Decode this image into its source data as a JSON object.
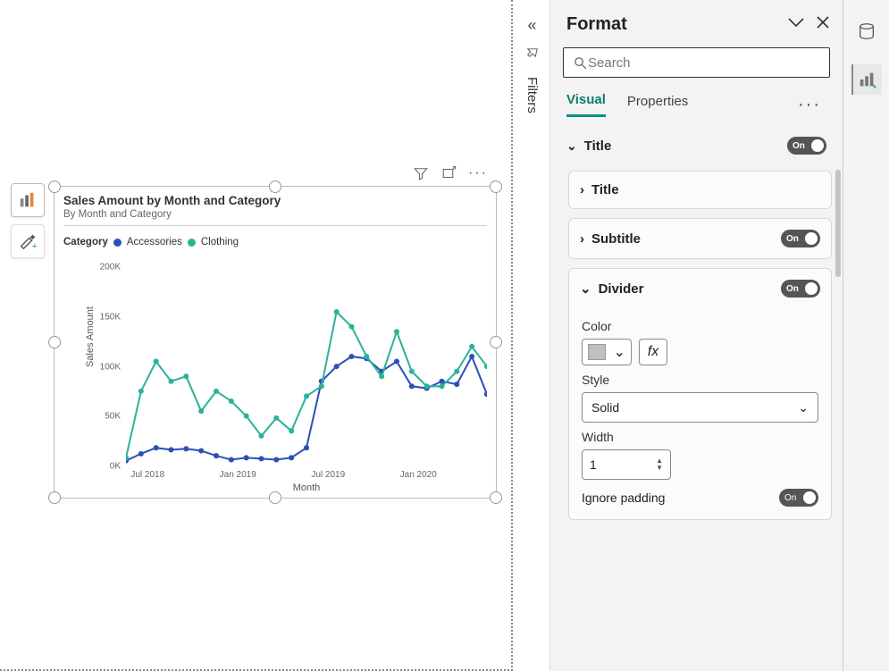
{
  "canvas": {
    "toolbar": {
      "build": "build-visual-icon",
      "format": "format-visual-icon"
    }
  },
  "viz": {
    "title": "Sales Amount by Month and Category",
    "subtitle": "By Month and Category",
    "legend_label": "Category",
    "series1_name": "Accessories",
    "series2_name": "Clothing",
    "y_label": "Sales Amount",
    "x_label": "Month",
    "y_ticks": [
      "200K",
      "150K",
      "100K",
      "50K",
      "0K"
    ],
    "x_ticks": [
      "Jul 2018",
      "Jan 2019",
      "Jul 2019",
      "Jan 2020"
    ]
  },
  "filters": {
    "label": "Filters"
  },
  "format": {
    "title": "Format",
    "search_placeholder": "Search",
    "tab_visual": "Visual",
    "tab_properties": "Properties",
    "section_title": "Title",
    "card_title": "Title",
    "card_subtitle": "Subtitle",
    "card_divider": "Divider",
    "label_color": "Color",
    "fx": "fx",
    "label_style": "Style",
    "style_value": "Solid",
    "label_width": "Width",
    "width_value": "1",
    "label_ignore": "Ignore padding",
    "toggle_on": "On"
  },
  "chart_data": {
    "type": "line",
    "title": "Sales Amount by Month and Category",
    "subtitle": "By Month and Category",
    "xlabel": "Month",
    "ylabel": "Sales Amount",
    "ylim": [
      0,
      200000
    ],
    "x": [
      "Jun 2018",
      "Jul 2018",
      "Aug 2018",
      "Sep 2018",
      "Oct 2018",
      "Nov 2018",
      "Dec 2018",
      "Jan 2019",
      "Feb 2019",
      "Mar 2019",
      "Apr 2019",
      "May 2019",
      "Jun 2019",
      "Jul 2019",
      "Aug 2019",
      "Sep 2019",
      "Oct 2019",
      "Nov 2019",
      "Dec 2019",
      "Jan 2020",
      "Feb 2020",
      "Mar 2020",
      "Apr 2020",
      "May 2020",
      "Jun 2020"
    ],
    "series": [
      {
        "name": "Accessories",
        "color": "#2c4fb8",
        "values": [
          5000,
          12000,
          18000,
          16000,
          17000,
          15000,
          10000,
          6000,
          8000,
          7000,
          6000,
          8000,
          18000,
          85000,
          100000,
          110000,
          108000,
          95000,
          105000,
          80000,
          78000,
          85000,
          82000,
          110000,
          72000
        ]
      },
      {
        "name": "Clothing",
        "color": "#2bb39a",
        "values": [
          8000,
          75000,
          105000,
          85000,
          90000,
          55000,
          75000,
          65000,
          50000,
          30000,
          48000,
          35000,
          70000,
          80000,
          155000,
          140000,
          110000,
          90000,
          135000,
          95000,
          80000,
          80000,
          95000,
          120000,
          100000
        ]
      }
    ]
  }
}
